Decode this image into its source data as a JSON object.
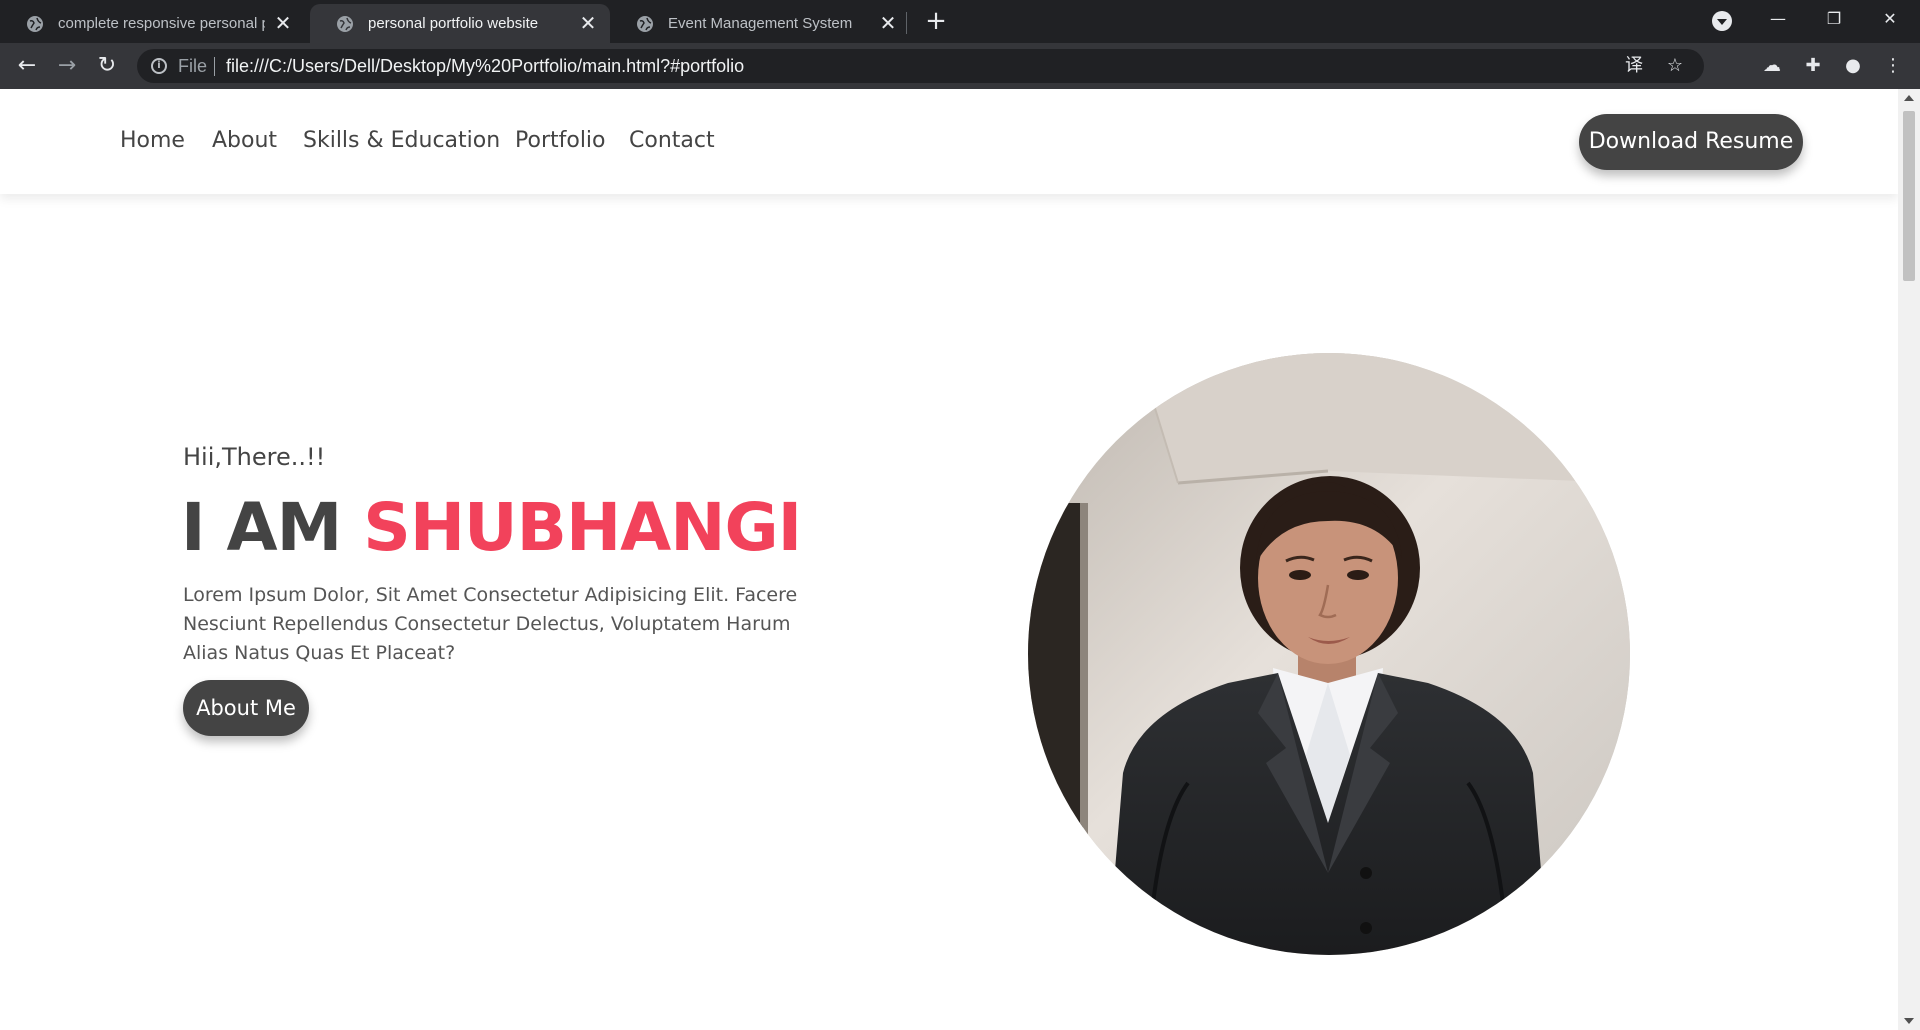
{
  "browser": {
    "tabs": [
      {
        "title": "complete responsive personal portfolio website",
        "active": false
      },
      {
        "title": "personal portfolio website",
        "active": true
      },
      {
        "title": "Event Management System",
        "active": false
      }
    ],
    "close_glyph": "✕",
    "new_tab_glyph": "+",
    "window_controls": {
      "minimize": "—",
      "restore": "❐",
      "close": "✕"
    },
    "address": {
      "scheme_label": "File",
      "url": "file:///C:/Users/Dell/Desktop/My%20Portfolio/main.html?#portfolio"
    },
    "icons": {
      "back": "←",
      "forward": "→",
      "reload": "↻",
      "translate": "译",
      "bookmark": "☆",
      "cloud": "☁",
      "extensions": "✚",
      "profile": "●",
      "menu": "⋮"
    }
  },
  "site": {
    "nav": [
      "Home",
      "About",
      "Skills & Education",
      "Portfolio",
      "Contact"
    ],
    "resume_button": "Download Resume",
    "hero": {
      "greeting": "Hii,There..!!",
      "title_prefix": "I AM",
      "title_name": "SHUBHANGI",
      "description": "Lorem Ipsum Dolor, Sit Amet Consectetur Adipisicing Elit. Facere Nesciunt Repellendus Consectetur Delectus, Voluptatem Harum Alias Natus Quas Et Placeat?",
      "button": "About Me"
    }
  },
  "colors": {
    "accent": "#f2425b",
    "dark": "#444444",
    "chrome_dark": "#202124",
    "chrome_toolbar": "#35363a"
  }
}
